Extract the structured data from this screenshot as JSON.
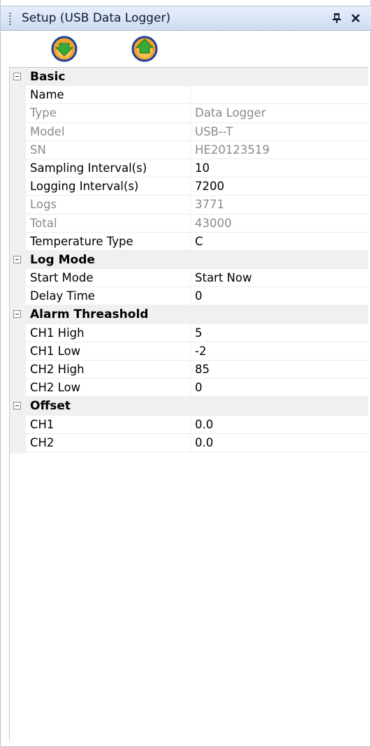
{
  "window": {
    "title": "Setup (USB Data Logger)",
    "pin_icon": "pin-icon",
    "close_icon": "close-icon"
  },
  "toolbar": {
    "buttons": [
      {
        "icon": "download-icon",
        "color": "#3aa83a"
      },
      {
        "icon": "upload-icon",
        "color": "#3aa83a"
      }
    ]
  },
  "colors": {
    "title_gradient_top": "#e6eefb",
    "title_gradient_bottom": "#cfdcf0",
    "category_bg": "#f0f0f0",
    "readonly_text": "#8a8a8a",
    "icon_orange": "#f2a12a",
    "icon_blue_ring": "#1a3f9e",
    "icon_green": "#3aa83a"
  },
  "categories": {
    "basic": {
      "label": "Basic",
      "rows": [
        {
          "name": "Name",
          "value": "",
          "readonly": false
        },
        {
          "name": "Type",
          "value": "Data Logger",
          "readonly": true
        },
        {
          "name": "Model",
          "value": "USB--T",
          "readonly": true
        },
        {
          "name": "SN",
          "value": "HE20123519",
          "readonly": true
        },
        {
          "name": "Sampling Interval(s)",
          "value": "10",
          "readonly": false
        },
        {
          "name": "Logging Interval(s)",
          "value": "7200",
          "readonly": false
        },
        {
          "name": "Logs",
          "value": "3771",
          "readonly": true
        },
        {
          "name": "Total",
          "value": "43000",
          "readonly": true
        },
        {
          "name": "Temperature Type",
          "value": "C",
          "readonly": false
        }
      ]
    },
    "log_mode": {
      "label": "Log Mode",
      "rows": [
        {
          "name": "Start Mode",
          "value": "Start Now",
          "readonly": false
        },
        {
          "name": "Delay Time",
          "value": "0",
          "readonly": false
        }
      ]
    },
    "alarm": {
      "label": "Alarm Threashold",
      "rows": [
        {
          "name": "CH1 High",
          "value": "5",
          "readonly": false
        },
        {
          "name": "CH1 Low",
          "value": "-2",
          "readonly": false
        },
        {
          "name": "CH2 High",
          "value": "85",
          "readonly": false
        },
        {
          "name": "CH2 Low",
          "value": "0",
          "readonly": false
        }
      ]
    },
    "offset": {
      "label": "Offset",
      "rows": [
        {
          "name": "CH1",
          "value": "0.0",
          "readonly": false
        },
        {
          "name": "CH2",
          "value": "0.0",
          "readonly": false
        }
      ]
    }
  }
}
